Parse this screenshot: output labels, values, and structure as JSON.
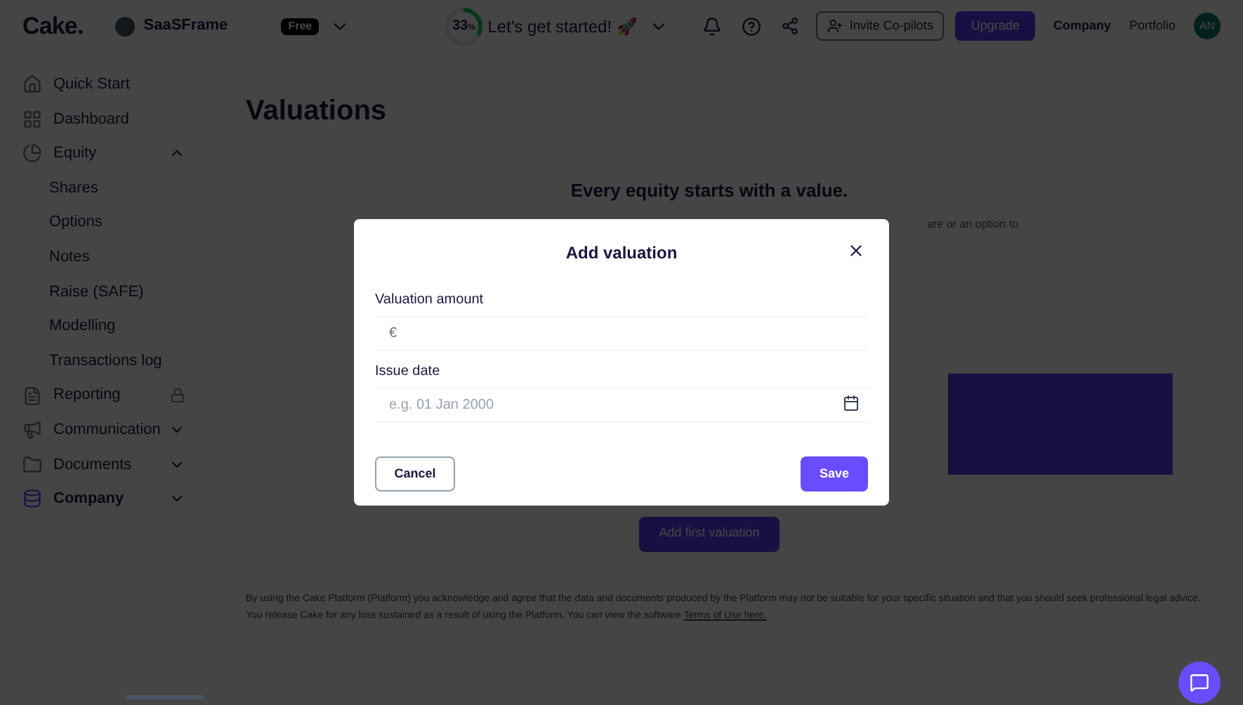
{
  "topbar": {
    "logo": "Cake.",
    "workspace": "SaaSFrame",
    "plan_badge": "Free",
    "progress": {
      "reading": "33",
      "unit": "%",
      "level": 0.33
    },
    "onboarding": "Let's get started! 🚀",
    "invite_button": "Invite Co-pilots",
    "upgrade_button": "Upgrade",
    "nav_links": [
      {
        "label": "Company",
        "selected": true
      },
      {
        "label": "Portfolio",
        "selected": false
      }
    ],
    "avatar": "AN"
  },
  "sidebar": {
    "items": [
      {
        "label": "Quick Start",
        "selected": false
      },
      {
        "label": "Dashboard",
        "selected": false
      },
      {
        "label": "Equity",
        "selected": false,
        "expanded": true,
        "children": [
          {
            "label": "Shares"
          },
          {
            "label": "Options"
          },
          {
            "label": "Notes"
          },
          {
            "label": "Raise (SAFE)"
          },
          {
            "label": "Modelling"
          },
          {
            "label": "Transactions log"
          }
        ]
      },
      {
        "label": "Reporting",
        "selected": false,
        "locked": true
      },
      {
        "label": "Communication",
        "selected": false,
        "expanded": false
      },
      {
        "label": "Documents",
        "selected": false,
        "expanded": false
      },
      {
        "label": "Company",
        "selected": true,
        "expanded": false
      }
    ]
  },
  "page": {
    "title": "Valuations",
    "empty_state": {
      "heading": "Every equity starts with a value.",
      "description_visible": "are or an option to",
      "button": "Add first valuation"
    },
    "disclaimer": "By using the Cake Platform (Platform) you acknowledge and agree that the data and documents produced by the Platform may not be suitable for your specific situation and that you should seek professional legal advice. You release Cake for any loss sustained as a result of using the Platform. You can view the software ",
    "disclaimer_link": "Terms of Use here."
  },
  "modal": {
    "title": "Add valuation",
    "fields": [
      {
        "label": "Valuation amount",
        "kind": "currency",
        "prefix": "€"
      },
      {
        "label": "Issue date",
        "kind": "date",
        "placeholder": "e.g. 01 Jan 2000"
      }
    ],
    "cancel_button": "Cancel",
    "save_button": "Save"
  }
}
